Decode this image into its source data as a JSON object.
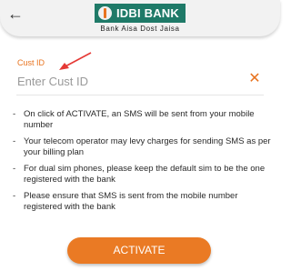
{
  "header": {
    "logo_text": "IDBI BANK",
    "tagline": "Bank Aisa Dost Jaisa"
  },
  "icons": {
    "back": "arrow-left-icon",
    "clear": "close-icon",
    "logo": "idbi-logo-icon",
    "annotation": "red-arrow-annotation"
  },
  "colors": {
    "accent": "#ea7a24",
    "brand_green": "#1f7a68",
    "annotation": "#e53935"
  },
  "form": {
    "label": "Cust ID",
    "placeholder": "Enter Cust ID",
    "value": ""
  },
  "notes": [
    "On click of ACTIVATE, an SMS will be sent from your mobile number",
    "Your telecom operator may levy charges for sending SMS as per your billing plan",
    "For dual sim phones, please keep the default sim to be the one registered with the bank",
    "Please ensure that SMS is sent from the mobile number registered with the bank"
  ],
  "actions": {
    "activate_label": "ACTIVATE"
  }
}
